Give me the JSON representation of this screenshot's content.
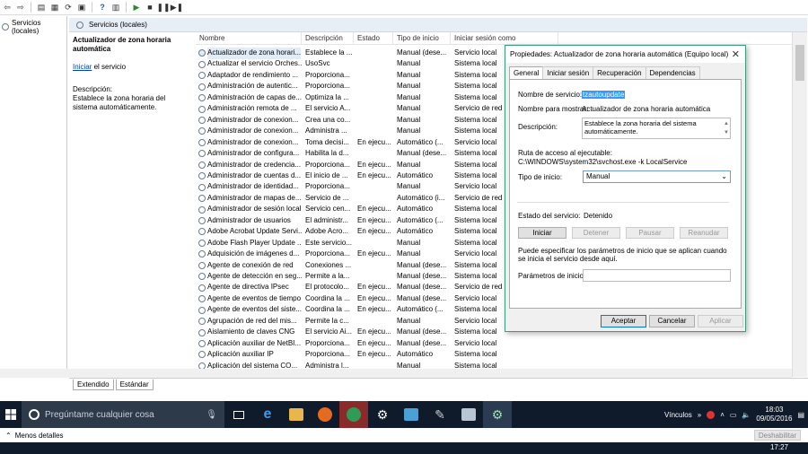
{
  "tree": {
    "root_label": "Servicios (locales)"
  },
  "header": {
    "title": "Servicios (locales)"
  },
  "description_pane": {
    "service_title": "Actualizador de zona horaria automática",
    "start_link": "Iniciar",
    "start_suffix": " el servicio",
    "desc_label": "Descripción:",
    "desc_text": "Establece la zona horaria del sistema automáticamente."
  },
  "table": {
    "columns": [
      "Nombre",
      "Descripción",
      "Estado",
      "Tipo de inicio",
      "Iniciar sesión como"
    ],
    "rows": [
      [
        "Actualizador de zona horari...",
        "Establece la ...",
        "",
        "Manual (dese...",
        "Servicio local"
      ],
      [
        "Actualizar el servicio Orches...",
        "UsoSvc",
        "",
        "Manual",
        "Sistema local"
      ],
      [
        "Adaptador de rendimiento ...",
        "Proporciona...",
        "",
        "Manual",
        "Sistema local"
      ],
      [
        "Administración de autentic...",
        "Proporciona...",
        "",
        "Manual",
        "Sistema local"
      ],
      [
        "Administración de capas de...",
        "Optimiza la ...",
        "",
        "Manual",
        "Sistema local"
      ],
      [
        "Administración remota de ...",
        "El servicio A...",
        "",
        "Manual",
        "Servicio de red"
      ],
      [
        "Administrador de conexion...",
        "Crea una co...",
        "",
        "Manual",
        "Sistema local"
      ],
      [
        "Administrador de conexion...",
        "Administra ...",
        "",
        "Manual",
        "Sistema local"
      ],
      [
        "Administrador de conexion...",
        "Toma decisi...",
        "En ejecu...",
        "Automático (...",
        "Servicio local"
      ],
      [
        "Administrador de configura...",
        "Habilita la d...",
        "",
        "Manual (dese...",
        "Sistema local"
      ],
      [
        "Administrador de credencia...",
        "Proporciona...",
        "En ejecu...",
        "Manual",
        "Sistema local"
      ],
      [
        "Administrador de cuentas d...",
        "El inicio de ...",
        "En ejecu...",
        "Automático",
        "Sistema local"
      ],
      [
        "Administrador de identidad...",
        "Proporciona...",
        "",
        "Manual",
        "Servicio local"
      ],
      [
        "Administrador de mapas de...",
        "Servicio de ...",
        "",
        "Automático (i...",
        "Servicio de red"
      ],
      [
        "Administrador de sesión local",
        "Servicio cen...",
        "En ejecu...",
        "Automático",
        "Sistema local"
      ],
      [
        "Administrador de usuarios",
        "El administr...",
        "En ejecu...",
        "Automático (...",
        "Sistema local"
      ],
      [
        "Adobe Acrobat Update Servi...",
        "Adobe Acro...",
        "En ejecu...",
        "Automático",
        "Sistema local"
      ],
      [
        "Adobe Flash Player Update ...",
        "Este servicio...",
        "",
        "Manual",
        "Sistema local"
      ],
      [
        "Adquisición de imágenes d...",
        "Proporciona...",
        "En ejecu...",
        "Manual",
        "Servicio local"
      ],
      [
        "Agente de conexión de red",
        "Conexiones ...",
        "",
        "Manual (dese...",
        "Sistema local"
      ],
      [
        "Agente de detección en seg...",
        "Permite a la...",
        "",
        "Manual (dese...",
        "Sistema local"
      ],
      [
        "Agente de directiva IPsec",
        "El protocolo...",
        "En ejecu...",
        "Manual (dese...",
        "Servicio de red"
      ],
      [
        "Agente de eventos de tiempo",
        "Coordina la ...",
        "En ejecu...",
        "Manual (dese...",
        "Servicio local"
      ],
      [
        "Agente de eventos del siste...",
        "Coordina la ...",
        "En ejecu...",
        "Automático (...",
        "Sistema local"
      ],
      [
        "Agrupación de red del mis...",
        "Permite la c...",
        "",
        "Manual",
        "Servicio local"
      ],
      [
        "Aislamiento de claves CNG",
        "El servicio Ai...",
        "En ejecu...",
        "Manual (dese...",
        "Sistema local"
      ],
      [
        "Aplicación auxiliar de NetBI...",
        "Proporciona...",
        "En ejecu...",
        "Manual (dese...",
        "Servicio local"
      ],
      [
        "Aplicación auxiliar IP",
        "Proporciona...",
        "En ejecu...",
        "Automático",
        "Sistema local"
      ],
      [
        "Aplicación del sistema CO...",
        "Administra l...",
        "",
        "Manual",
        "Sistema local"
      ]
    ]
  },
  "bottom_tabs": [
    "Extendido",
    "Estándar"
  ],
  "dialog": {
    "title": "Propiedades: Actualizador de zona horaria automática (Equipo local)",
    "tabs": [
      "General",
      "Iniciar sesión",
      "Recuperación",
      "Dependencias"
    ],
    "service_name_label": "Nombre de servicio:",
    "service_name": "tzautoupdate",
    "display_name_label": "Nombre para mostrar:",
    "display_name": "Actualizador de zona horaria automática",
    "description_label": "Descripción:",
    "description": "Establece la zona horaria del sistema automáticamente.",
    "path_label": "Ruta de acceso al ejecutable:",
    "path": "C:\\WINDOWS\\system32\\svchost.exe -k LocalService",
    "startup_label": "Tipo de inicio:",
    "startup_value": "Manual",
    "status_label": "Estado del servicio:",
    "status_value": "Detenido",
    "btn_start": "Iniciar",
    "btn_stop": "Detener",
    "btn_pause": "Pausar",
    "btn_resume": "Reanudar",
    "hint": "Puede especificar los parámetros de inicio que se aplican cuando se inicia el servicio desde aquí.",
    "params_label": "Parámetros de inicio:",
    "params_value": "",
    "ok": "Aceptar",
    "cancel": "Cancelar",
    "apply": "Aplicar"
  },
  "taskbar": {
    "search_placeholder": "Pregúntame cualquier cosa",
    "links_label": "Vínculos",
    "time": "18:03",
    "date": "09/05/2016"
  },
  "below": {
    "menos": "Menos detalles",
    "deshabilitar": "Deshabilitar",
    "time2": "17:27"
  }
}
